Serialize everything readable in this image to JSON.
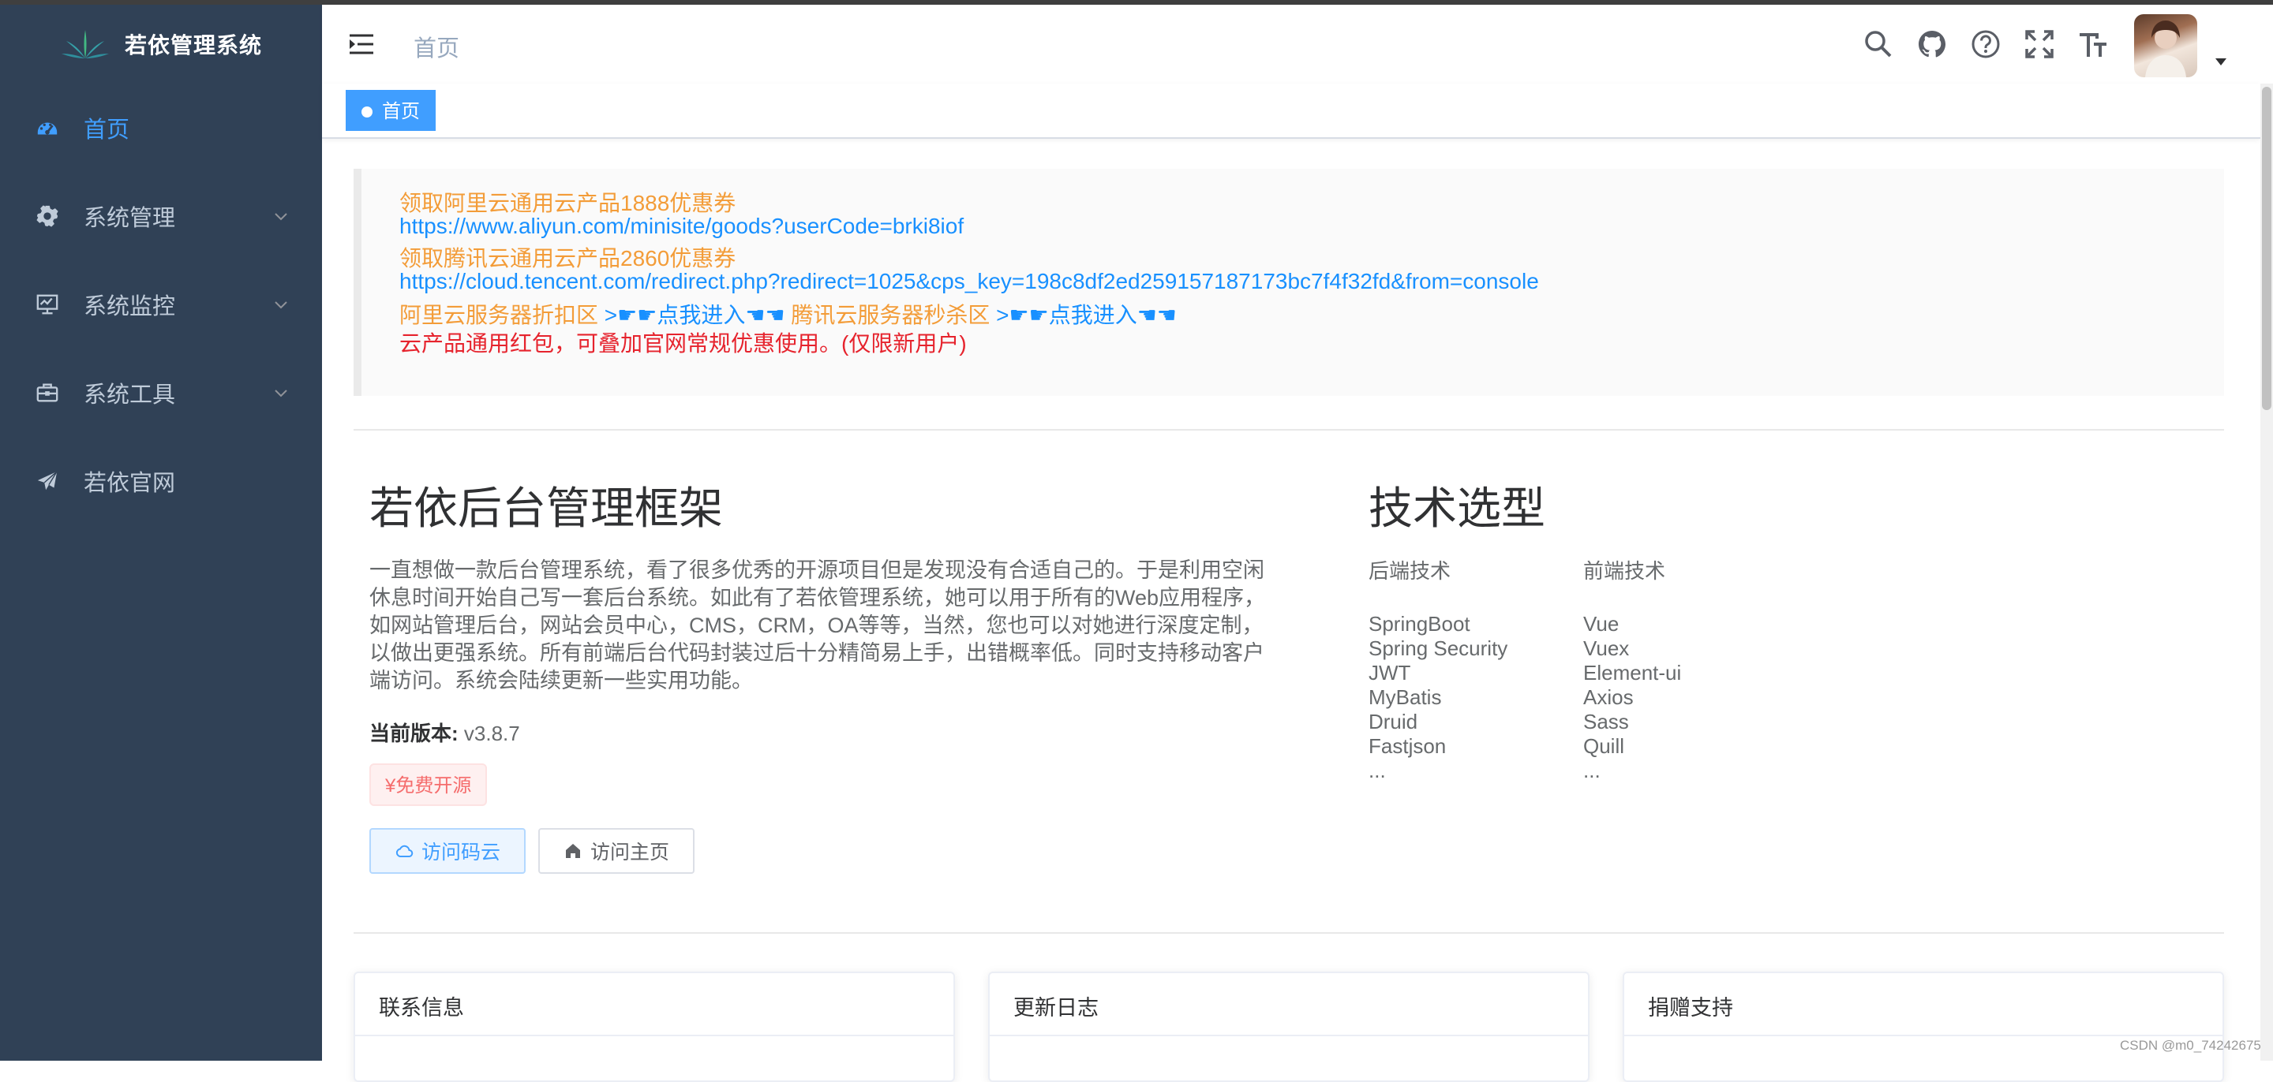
{
  "app": {
    "title": "若依管理系统"
  },
  "sidebar": {
    "items": [
      {
        "label": "首页",
        "icon": "dashboard-icon",
        "active": true
      },
      {
        "label": "系统管理",
        "icon": "gear-icon",
        "expandable": true
      },
      {
        "label": "系统监控",
        "icon": "monitor-icon",
        "expandable": true
      },
      {
        "label": "系统工具",
        "icon": "toolbox-icon",
        "expandable": true
      },
      {
        "label": "若依官网",
        "icon": "paper-plane-icon"
      }
    ]
  },
  "header": {
    "breadcrumb": "首页",
    "icons": [
      "search-icon",
      "github-icon",
      "help-icon",
      "fullscreen-icon",
      "font-size-icon"
    ]
  },
  "tags": [
    {
      "label": "首页",
      "active": true
    }
  ],
  "notice": {
    "aliyun_label": "领取阿里云通用云产品1888优惠券",
    "aliyun_url": "https://www.aliyun.com/minisite/goods?userCode=brki8iof",
    "tencent_label": "领取腾讯云通用云产品2860优惠券",
    "tencent_url": "https://cloud.tencent.com/redirect.php?redirect=1025&cps_key=198c8df2ed259157187173bc7f4f32fd&from=console",
    "aliyun_zone": "阿里云服务器折扣区",
    "enter_link": ">☛☛点我进入☚☚",
    "tencent_zone": "腾讯云服务器秒杀区",
    "red_note": "云产品通用红包，可叠加官网常规优惠使用。(仅限新用户)"
  },
  "intro": {
    "title": "若依后台管理框架",
    "description": "一直想做一款后台管理系统，看了很多优秀的开源项目但是发现没有合适自己的。于是利用空闲休息时间开始自己写一套后台系统。如此有了若依管理系统，她可以用于所有的Web应用程序，如网站管理后台，网站会员中心，CMS，CRM，OA等等，当然，您也可以对她进行深度定制，以做出更强系统。所有前端后台代码封装过后十分精简易上手，出错概率低。同时支持移动客户端访问。系统会陆续更新一些实用功能。",
    "version_label": "当前版本:",
    "version": "v3.8.7",
    "badge": "¥免费开源",
    "btn_gitee": "访问码云",
    "btn_home": "访问主页"
  },
  "tech": {
    "title": "技术选型",
    "backend": {
      "head": "后端技术",
      "items": [
        "SpringBoot",
        "Spring Security",
        "JWT",
        "MyBatis",
        "Druid",
        "Fastjson",
        "..."
      ]
    },
    "frontend": {
      "head": "前端技术",
      "items": [
        "Vue",
        "Vuex",
        "Element-ui",
        "Axios",
        "Sass",
        "Quill",
        "..."
      ]
    }
  },
  "cards": [
    "联系信息",
    "更新日志",
    "捐赠支持"
  ],
  "watermark": "CSDN @m0_74242675",
  "colors": {
    "sidebar": "#304156",
    "primary": "#409eff",
    "orange": "#f39c38",
    "red": "#e6232d"
  }
}
